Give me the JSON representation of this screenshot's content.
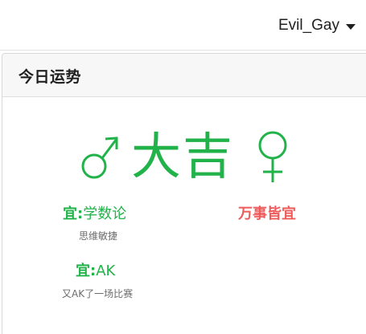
{
  "header": {
    "username": "Evil_Gay"
  },
  "card": {
    "title": "今日运势",
    "fortune": "大吉",
    "male_symbol": "male-icon",
    "female_symbol": "female-icon",
    "good_color": "#21b34a",
    "bad_color": "#ef5a5a",
    "yi_items": [
      {
        "prefix": "宜:",
        "text": "学数论",
        "detail": "思维敏捷"
      },
      {
        "prefix": "宜:",
        "text": "AK",
        "detail": "又AK了一场比赛"
      }
    ],
    "all_good": "万事皆宜"
  }
}
